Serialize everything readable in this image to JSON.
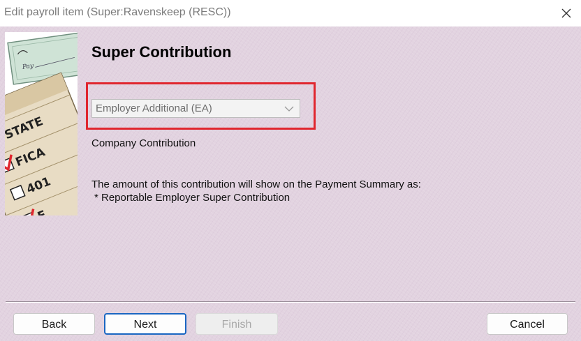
{
  "window": {
    "title": "Edit payroll item (Super:Ravenskeep (RESC))"
  },
  "side_image": {
    "checklist_items": [
      "STATE",
      "FICA",
      "401",
      "F"
    ],
    "check_line_text": "Pay"
  },
  "page": {
    "heading": "Super Contribution",
    "contribution_type": {
      "selected": "Employer Additional (EA)"
    },
    "company_contribution_label": "Company Contribution",
    "payment_summary_text": "The amount of this contribution will show on the Payment Summary as:",
    "reportable_text": "* Reportable Employer Super Contribution"
  },
  "buttons": {
    "back": "Back",
    "next": "Next",
    "finish": "Finish",
    "cancel": "Cancel"
  },
  "colors": {
    "background": "#e2d3e0",
    "highlight": "#e0262e",
    "default_button_border": "#1a66c2"
  }
}
